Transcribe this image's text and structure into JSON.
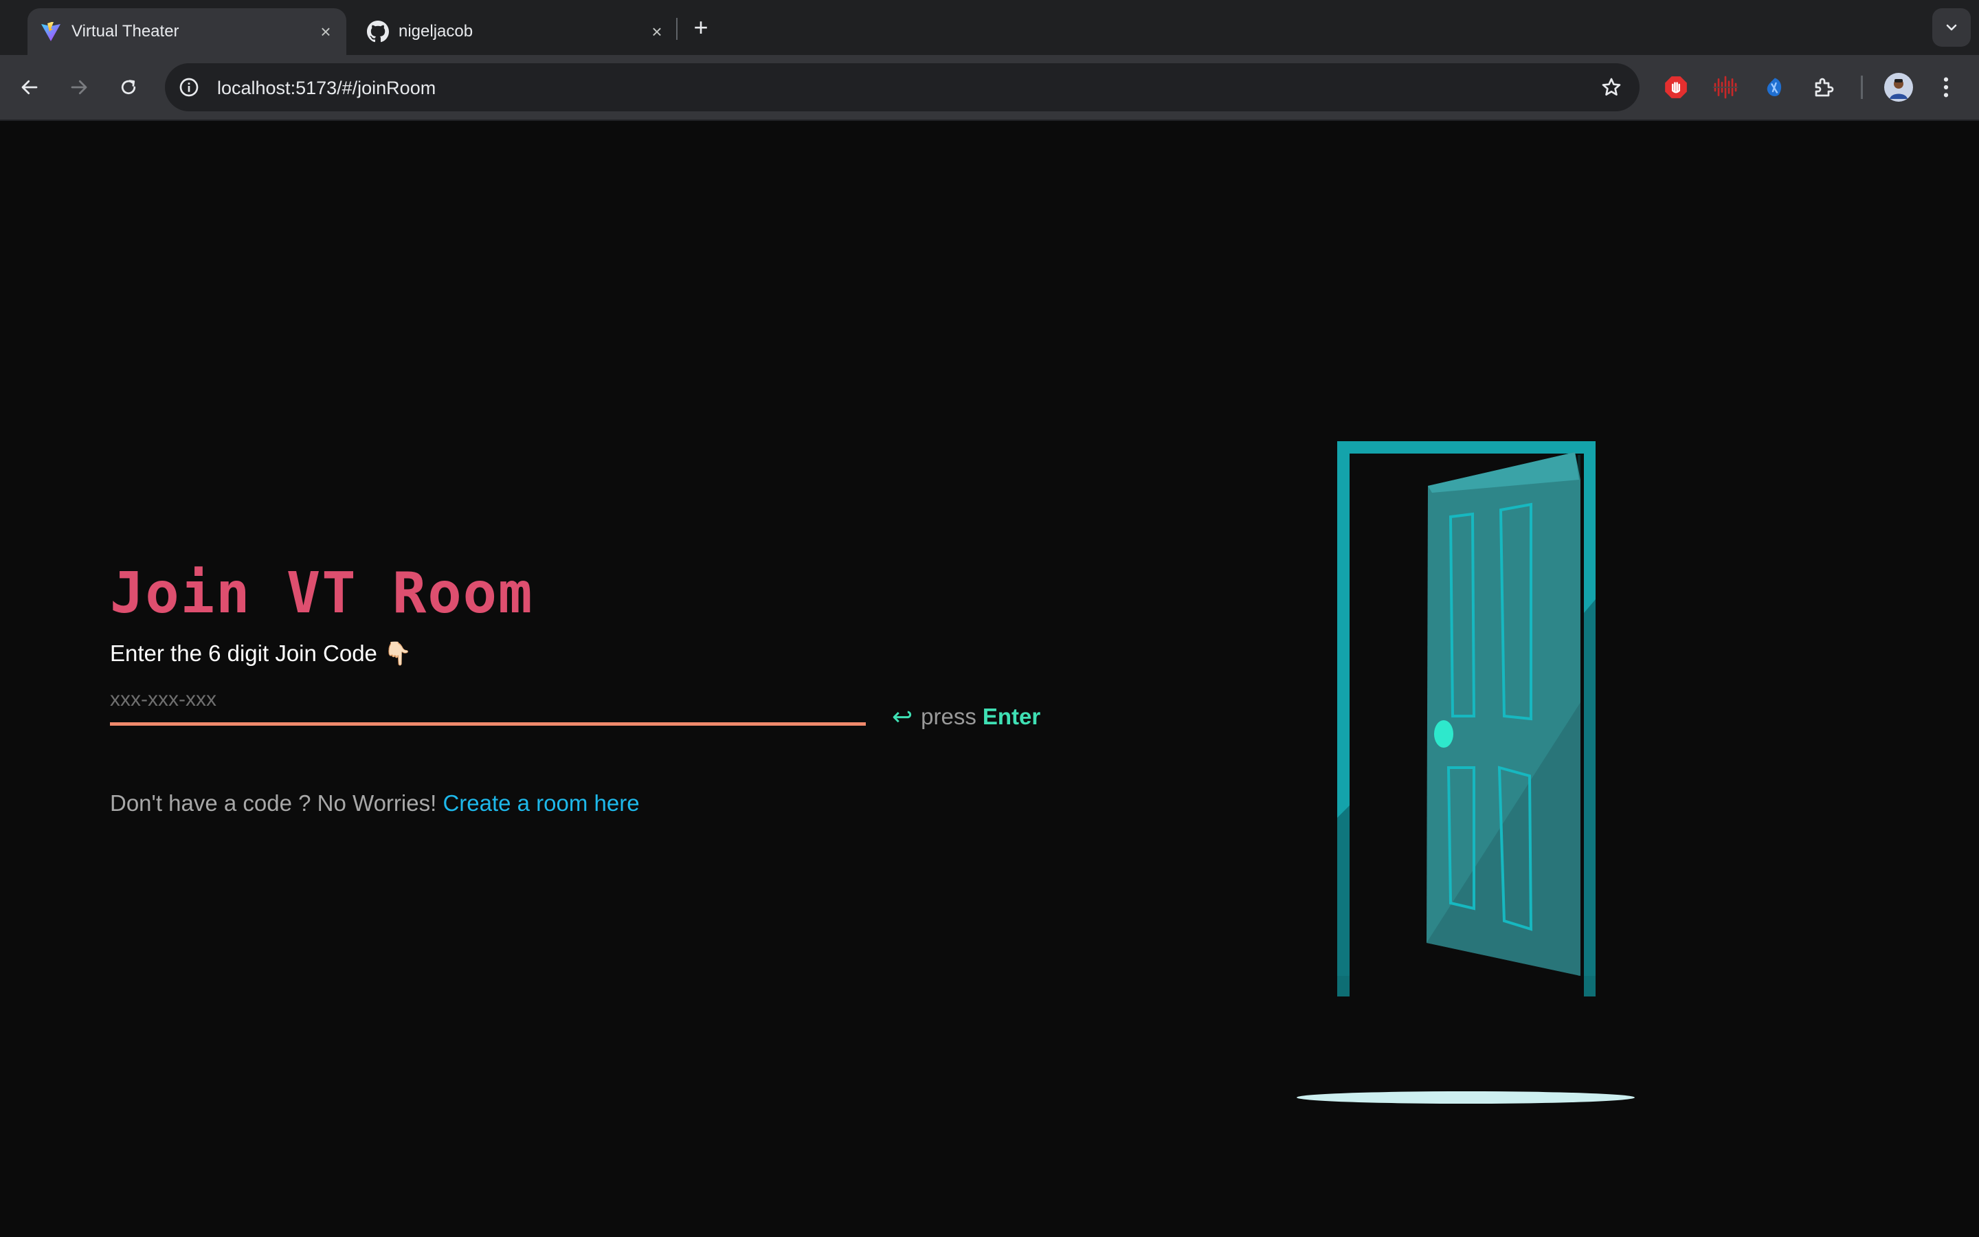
{
  "browser": {
    "tabs": [
      {
        "title": "Virtual Theater",
        "active": true,
        "favicon": "vite-logo-icon",
        "close": "×"
      },
      {
        "title": "nigeljacob",
        "active": false,
        "favicon": "github-icon",
        "close": "×"
      }
    ],
    "new_tab": "+",
    "url": "localhost:5173/#/joinRoom",
    "extensions": [
      "adblock-icon",
      "audio-waveform-extension-icon",
      "blue-extension-icon",
      "puzzle-extensions-icon"
    ]
  },
  "page": {
    "heading": "Join VT Room",
    "prompt": "Enter the 6 digit Join Code 👇🏻",
    "input": {
      "placeholder": "xxx-xxx-xxx",
      "value": ""
    },
    "press_hint": {
      "icon": "↩",
      "press": "press",
      "key": "Enter"
    },
    "footer": {
      "text": "Don't have a code ? No Worries!",
      "link": "Create a room here"
    },
    "illustration": "open-door-illustration"
  },
  "colors": {
    "page_background": "#0b0b0b",
    "heading": "#de4f6f",
    "input_underline": "#f0896c",
    "accent_green": "#3fe0b4",
    "link": "#1eb8ea",
    "door_teal": "#14a3ab"
  }
}
